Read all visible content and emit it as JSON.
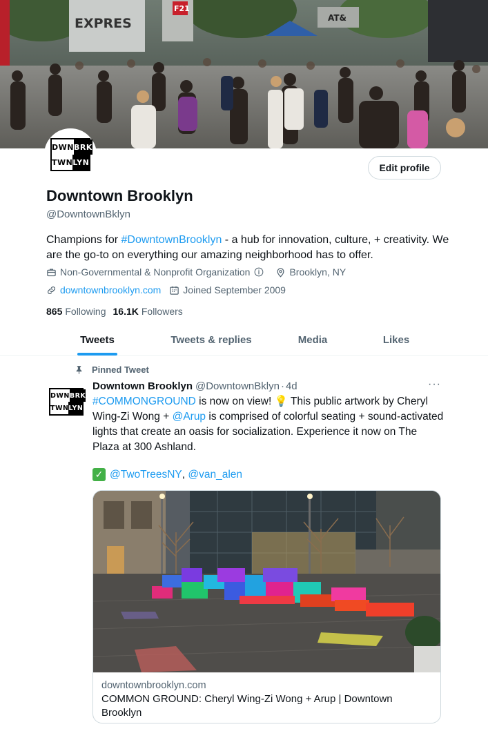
{
  "profile": {
    "name": "Downtown Brooklyn",
    "handle": "@DowntownBklyn",
    "edit_label": "Edit profile",
    "bio_prefix": "Champions for ",
    "bio_hashtag": "#DowntownBrooklyn",
    "bio_suffix": " - a hub for innovation, culture, + creativity. We are the go-to on everything our amazing neighborhood has to offer.",
    "category": "Non-Governmental & Nonprofit Organization",
    "location": "Brooklyn, NY",
    "website": "downtownbrooklyn.com",
    "joined": "Joined September 2009",
    "following_count": "865",
    "following_label": "Following",
    "followers_count": "16.1K",
    "followers_label": "Followers",
    "logo": {
      "tl": "DWN",
      "tr": "BRK",
      "bl": "TWN",
      "br": "LYN"
    }
  },
  "tabs": [
    {
      "label": "Tweets",
      "active": true
    },
    {
      "label": "Tweets & replies",
      "active": false
    },
    {
      "label": "Media",
      "active": false
    },
    {
      "label": "Likes",
      "active": false
    }
  ],
  "tweet": {
    "pinned_label": "Pinned Tweet",
    "author": "Downtown Brooklyn",
    "handle": "@DowntownBklyn",
    "separator": "·",
    "time": "4d",
    "more": "···",
    "hashtag": "#COMMONGROUND",
    "text_1": " is now on view! ",
    "emoji": "💡",
    "text_2": " This public artwork by Cheryl Wing-Zi Wong + ",
    "mention_1": "@Arup",
    "text_3": " is comprised of colorful seating + sound-activated lights that create an oasis for socialization. Experience it now on The Plaza at 300 Ashland.",
    "check": "✓",
    "mention_2": "@TwoTreesNY",
    "comma": ", ",
    "mention_3": "@van_alen",
    "card_domain": "downtownbrooklyn.com",
    "card_title": "COMMON GROUND: Cheryl Wing-Zi Wong + Arup | Downtown Brooklyn"
  },
  "banner": {
    "sign_1": "EXPRES",
    "sign_2": "F21",
    "sign_3": "AT&"
  },
  "colors": {
    "accent": "#1d9bf0",
    "text": "#0f1419",
    "secondary": "#536471"
  },
  "icons": [
    "briefcase-icon",
    "info-icon",
    "location-pin-icon",
    "link-icon",
    "calendar-icon",
    "pin-icon",
    "more-icon",
    "check-mark-icon",
    "lightbulb-icon"
  ]
}
